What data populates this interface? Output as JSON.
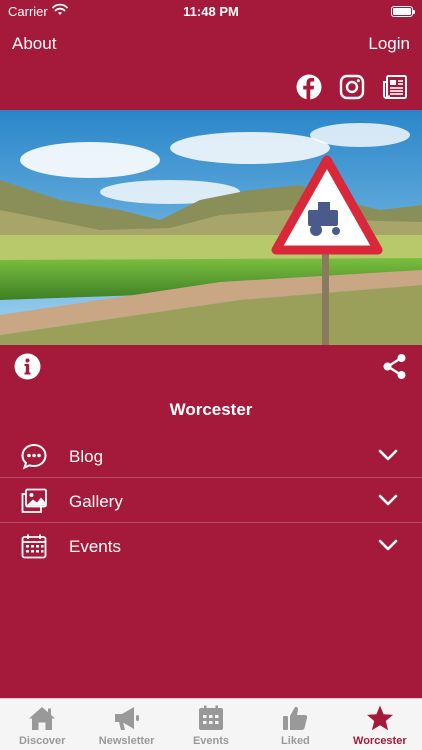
{
  "status": {
    "carrier": "Carrier",
    "time": "11:48 PM"
  },
  "nav": {
    "about": "About",
    "login": "Login"
  },
  "social": [
    "facebook-icon",
    "instagram-icon",
    "newspaper-icon"
  ],
  "place": {
    "title": "Worcester"
  },
  "menu": [
    {
      "label": "Blog",
      "icon": "chat-bubble-icon"
    },
    {
      "label": "Gallery",
      "icon": "gallery-icon"
    },
    {
      "label": "Events",
      "icon": "calendar-icon"
    }
  ],
  "tabs": [
    {
      "label": "Discover",
      "icon": "house-icon"
    },
    {
      "label": "Newsletter",
      "icon": "megaphone-icon"
    },
    {
      "label": "Events",
      "icon": "calendar-icon"
    },
    {
      "label": "Liked",
      "icon": "thumbs-up-icon"
    },
    {
      "label": "Worcester",
      "icon": "star-icon",
      "active": true
    }
  ],
  "colors": {
    "primary": "#a51a3a",
    "tab_inactive": "#999999",
    "tabbar_bg": "#f5f5f5"
  }
}
